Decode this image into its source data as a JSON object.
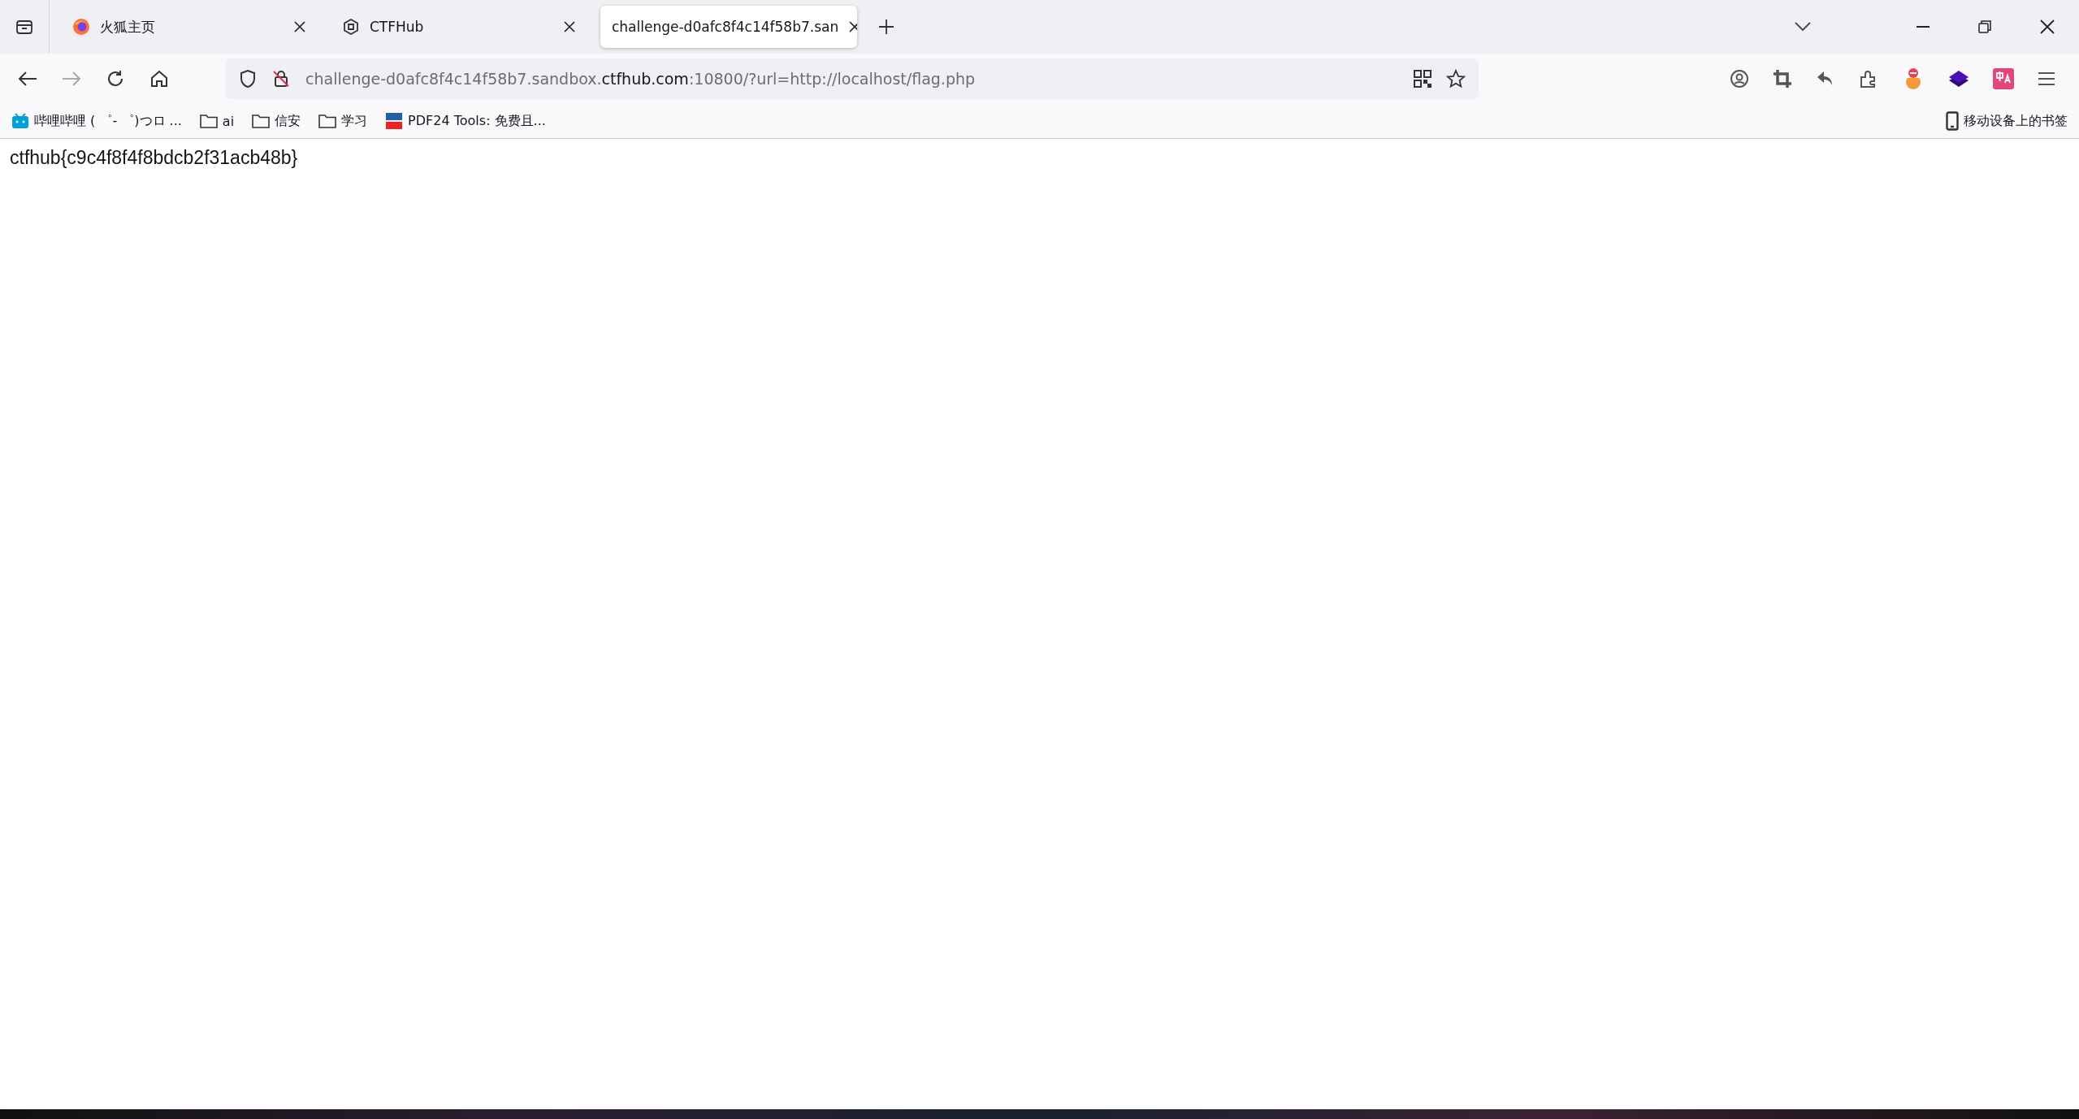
{
  "tabs": [
    {
      "title": "火狐主页",
      "kind": "firefox",
      "selected": false
    },
    {
      "title": "CTFHub",
      "kind": "ctfhub",
      "selected": false
    },
    {
      "title": "challenge-d0afc8f4c14f58b7.san",
      "kind": "plain",
      "selected": true
    }
  ],
  "address_bar": {
    "before": "challenge-d0afc8f4c14f58b7.sandbox.",
    "domain": "ctfhub.com",
    "after": ":10800/?url=http://localhost/flag.php"
  },
  "bookmarks": [
    {
      "label": "哔哩哔哩 ( ゜- ゜)つロ ...",
      "kind": "tv"
    },
    {
      "label": "ai",
      "kind": "folder"
    },
    {
      "label": "信安",
      "kind": "folder"
    },
    {
      "label": "学习",
      "kind": "folder"
    },
    {
      "label": "PDF24 Tools: 免费且...",
      "kind": "pdf"
    }
  ],
  "mobile_bookmarks": "移动设备上的书签",
  "page": {
    "text": "ctfhub{c9c4f8f4f8bdcb2f31acb48b}"
  }
}
